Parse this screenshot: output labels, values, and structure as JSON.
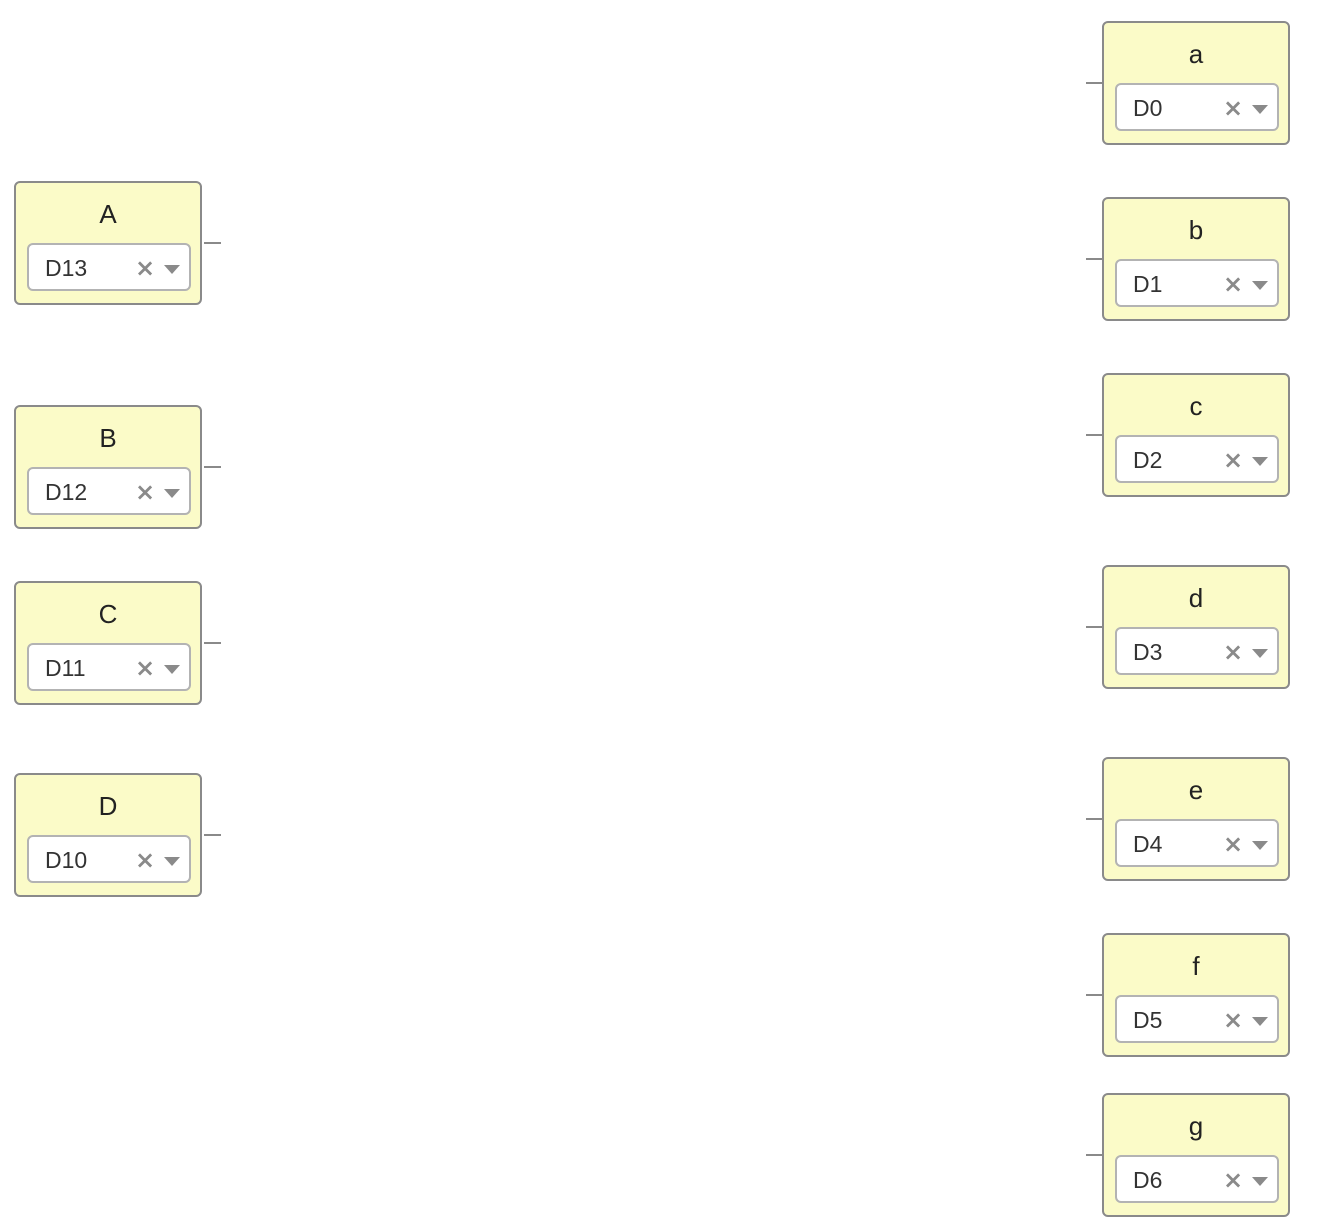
{
  "nodes": {
    "A": {
      "label": "A",
      "value": "D13"
    },
    "B": {
      "label": "B",
      "value": "D12"
    },
    "C": {
      "label": "C",
      "value": "D11"
    },
    "D": {
      "label": "D",
      "value": "D10"
    },
    "a": {
      "label": "a",
      "value": "D0"
    },
    "b": {
      "label": "b",
      "value": "D1"
    },
    "c": {
      "label": "c",
      "value": "D2"
    },
    "d": {
      "label": "d",
      "value": "D3"
    },
    "e": {
      "label": "e",
      "value": "D4"
    },
    "f": {
      "label": "f",
      "value": "D5"
    },
    "g": {
      "label": "g",
      "value": "D6"
    }
  },
  "icons": {
    "clear": "clear-icon",
    "dropdown": "chevron-down-icon"
  },
  "colors": {
    "node_fill": "#fbfbc8",
    "node_border": "#8a8a8a",
    "select_border": "#b3b3b3"
  }
}
